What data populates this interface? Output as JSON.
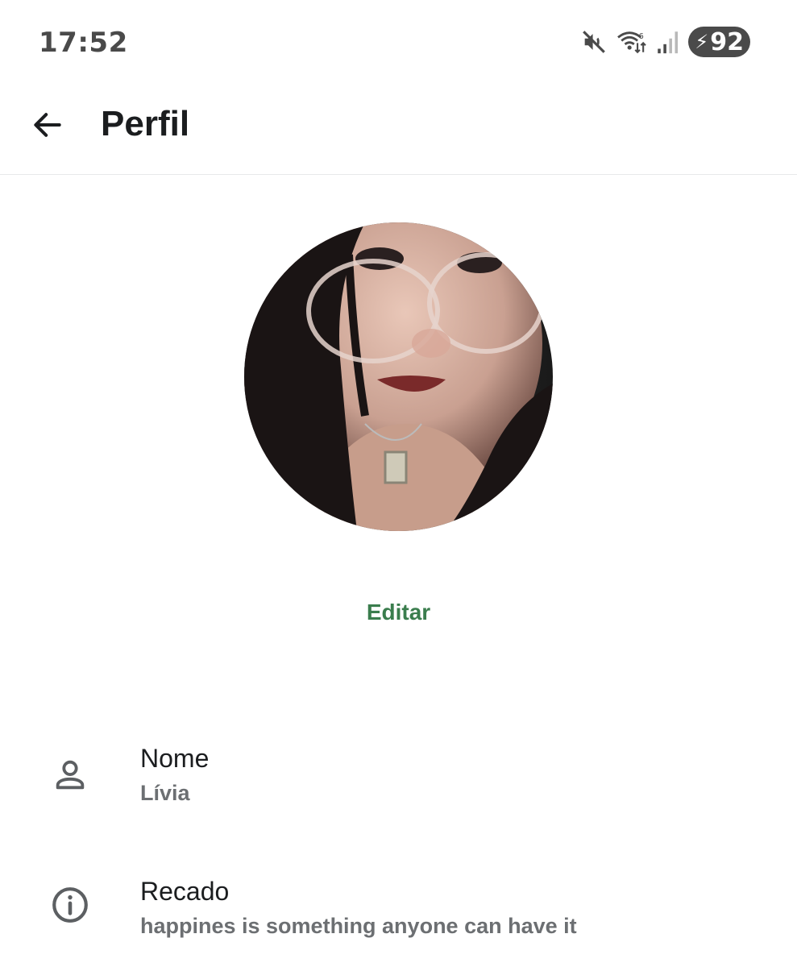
{
  "status_bar": {
    "time": "17:52",
    "battery_level": "92",
    "icons": [
      "mute-icon",
      "wifi-icon",
      "signal-icon",
      "battery-charging-icon"
    ]
  },
  "app_bar": {
    "title": "Perfil",
    "back_icon": "arrow-left-icon"
  },
  "profile": {
    "edit_label": "Editar"
  },
  "rows": {
    "name": {
      "label": "Nome",
      "value": "Lívia",
      "icon": "person-icon"
    },
    "about": {
      "label": "Recado",
      "value": "happines is something anyone can have it",
      "icon": "info-icon"
    }
  },
  "colors": {
    "accent": "#3a7d4d",
    "text_primary": "#1b1d1f",
    "text_secondary": "#6c6f72",
    "status": "#4a4a4a"
  }
}
